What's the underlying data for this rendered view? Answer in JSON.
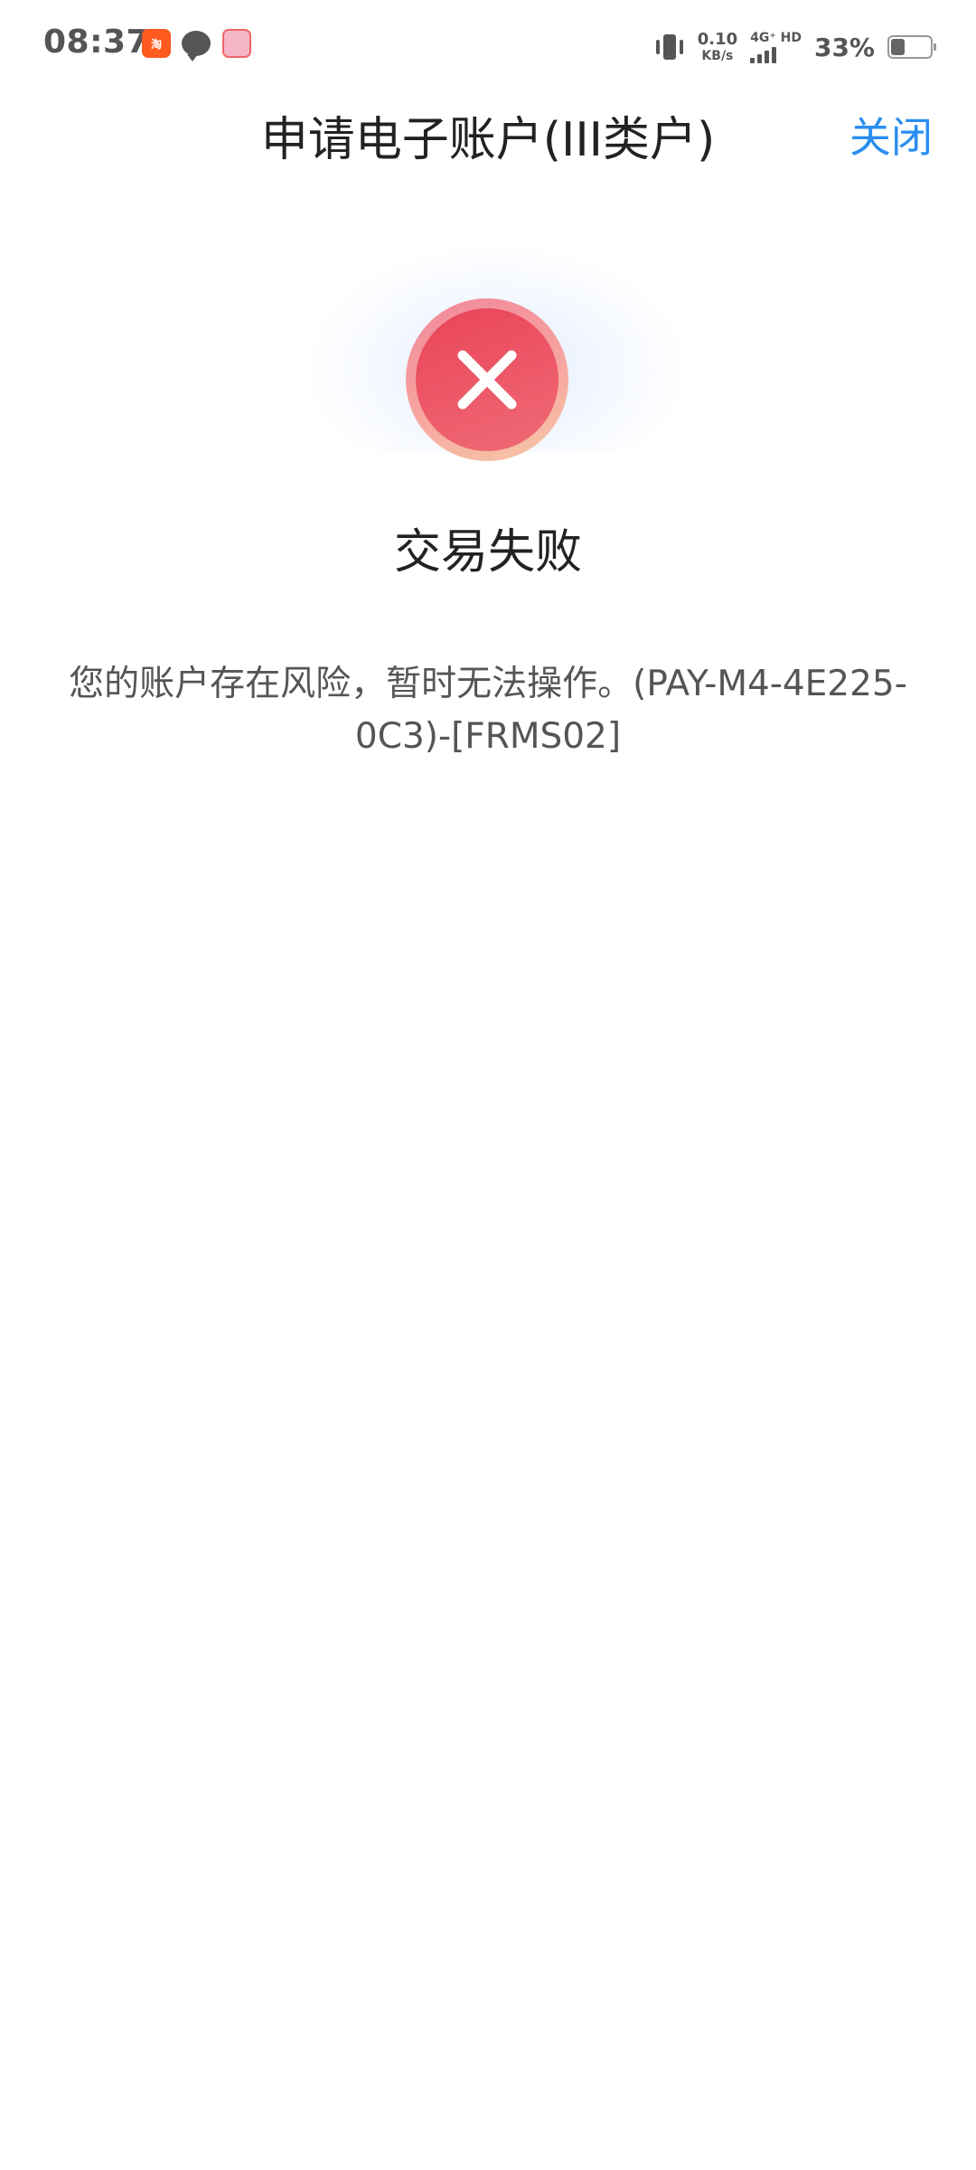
{
  "status_bar": {
    "time": "08:37",
    "net_speed_value": "0.10",
    "net_speed_unit": "KB/s",
    "network_label": "4G⁺ HD",
    "battery_percent_text": "33%",
    "battery_level": 0.33,
    "notification_icons": [
      "taobao-icon",
      "message-icon",
      "pink-app-icon"
    ]
  },
  "header": {
    "title": "申请电子账户(III类户)",
    "close_label": "关闭",
    "close_color": "#2a8df0"
  },
  "result": {
    "icon": "error-x-icon",
    "icon_color": "#e94458",
    "title": "交易失败",
    "message": "您的账户存在风险，暂时无法操作。(PAY-M4-4E225-0C3)-[FRMS02]"
  }
}
